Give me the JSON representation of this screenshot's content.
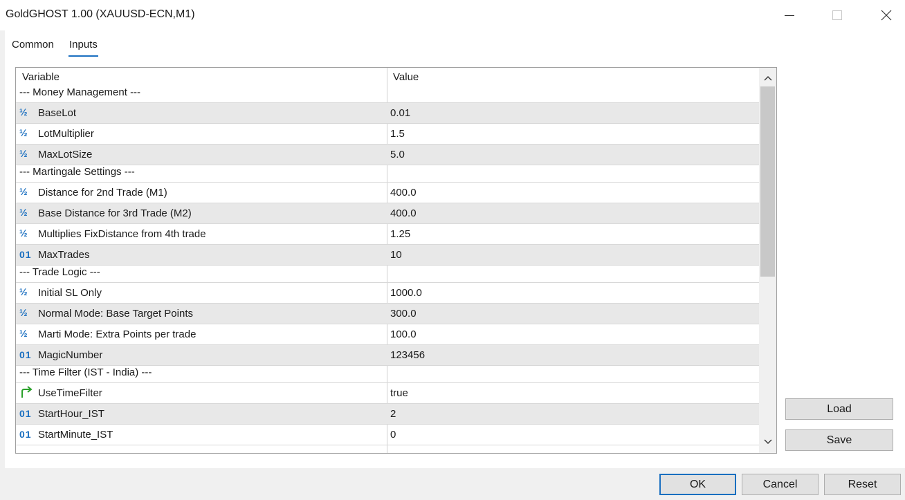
{
  "window": {
    "title": "GoldGHOST 1.00 (XAUUSD-ECN,M1)"
  },
  "tabs": [
    {
      "label": "Common"
    },
    {
      "label": "Inputs"
    }
  ],
  "grid": {
    "headers": {
      "variable": "Variable",
      "value": "Value"
    },
    "rows": [
      {
        "type": "section",
        "name": "--- Money Management ---",
        "value": ""
      },
      {
        "type": "double",
        "icon": "half-icon",
        "name": "BaseLot",
        "value": "0.01"
      },
      {
        "type": "double",
        "icon": "half-icon",
        "name": "LotMultiplier",
        "value": "1.5"
      },
      {
        "type": "double",
        "icon": "half-icon",
        "name": "MaxLotSize",
        "value": "5.0"
      },
      {
        "type": "section",
        "name": "--- Martingale Settings ---",
        "value": ""
      },
      {
        "type": "double",
        "icon": "half-icon",
        "name": "Distance for 2nd Trade (M1)",
        "value": "400.0"
      },
      {
        "type": "double",
        "icon": "half-icon",
        "name": "Base Distance for 3rd Trade (M2)",
        "value": "400.0"
      },
      {
        "type": "double",
        "icon": "half-icon",
        "name": "Multiplies FixDistance from 4th trade",
        "value": "1.25"
      },
      {
        "type": "int",
        "icon": "integer-icon",
        "name": "MaxTrades",
        "value": "10"
      },
      {
        "type": "section",
        "name": "--- Trade Logic ---",
        "value": ""
      },
      {
        "type": "double",
        "icon": "half-icon",
        "name": "Initial SL Only",
        "value": "1000.0"
      },
      {
        "type": "double",
        "icon": "half-icon",
        "name": "Normal Mode: Base Target Points",
        "value": "300.0"
      },
      {
        "type": "double",
        "icon": "half-icon",
        "name": "Marti Mode: Extra Points per trade",
        "value": "100.0"
      },
      {
        "type": "int",
        "icon": "integer-icon",
        "name": "MagicNumber",
        "value": "123456"
      },
      {
        "type": "section",
        "name": "--- Time Filter (IST - India) ---",
        "value": ""
      },
      {
        "type": "bool",
        "icon": "boolean-arrow-icon",
        "name": "UseTimeFilter",
        "value": "true"
      },
      {
        "type": "int",
        "icon": "integer-icon",
        "name": "StartHour_IST",
        "value": "2"
      },
      {
        "type": "int",
        "icon": "integer-icon",
        "name": "StartMinute_IST",
        "value": "0"
      }
    ]
  },
  "icons": {
    "half": "½",
    "int": "01"
  },
  "buttons": {
    "load": "Load",
    "save": "Save",
    "ok": "OK",
    "cancel": "Cancel",
    "reset": "Reset"
  },
  "colors": {
    "accent": "#1a6fc0",
    "bool_icon": "#2aa02a",
    "alt_row": "#e8e8e8"
  }
}
